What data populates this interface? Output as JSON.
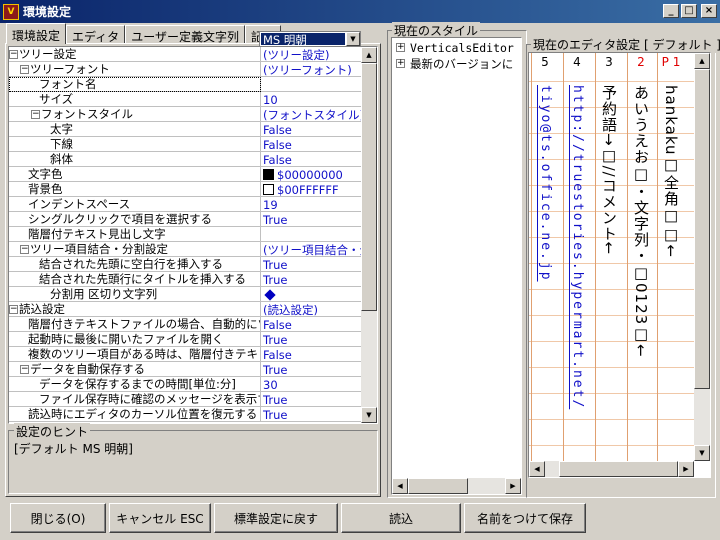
{
  "window": {
    "title": "環境設定",
    "buttons": {
      "minimize": "_",
      "maximize": "□",
      "close": "×"
    }
  },
  "tabs": [
    "環境設定",
    "エディタ",
    "ユーザー定義文字列",
    "記号"
  ],
  "settings": {
    "rows": [
      {
        "name": "ツリー設定",
        "value": "(ツリー設定)",
        "level": 0,
        "expander": "minus"
      },
      {
        "name": "ツリーフォント",
        "value": "(ツリーフォント)",
        "level": 1,
        "expander": "minus"
      },
      {
        "name": "フォント名",
        "value": "",
        "level": 2,
        "selected": true
      },
      {
        "name": "サイズ",
        "value": "10",
        "level": 2
      },
      {
        "name": "フォントスタイル",
        "value": "(フォントスタイル)",
        "level": 2,
        "expander": "minus"
      },
      {
        "name": "太字",
        "value": "False",
        "level": 3
      },
      {
        "name": "下線",
        "value": "False",
        "level": 3
      },
      {
        "name": "斜体",
        "value": "False",
        "level": 3
      },
      {
        "name": "文字色",
        "value": "$00000000",
        "level": 1,
        "swatch": "#000000"
      },
      {
        "name": "背景色",
        "value": "$00FFFFFF",
        "level": 1,
        "swatch": "#ffffff"
      },
      {
        "name": "インデントスペース",
        "value": "19",
        "level": 1
      },
      {
        "name": "シングルクリックで項目を選択する",
        "value": "True",
        "level": 1
      },
      {
        "name": "階層付テキスト見出し文字",
        "value": "",
        "level": 1
      },
      {
        "name": "ツリー項目結合・分割設定",
        "value": "(ツリー項目結合・分",
        "level": 1,
        "expander": "minus"
      },
      {
        "name": "結合された先頭に空白行を挿入する",
        "value": "True",
        "level": 2
      },
      {
        "name": "結合された先頭行にタイトルを挿入する",
        "value": "True",
        "level": 2
      },
      {
        "name": "分割用 区切り文字列",
        "value": "",
        "level": 3,
        "diamond": true
      },
      {
        "name": "読込設定",
        "value": "(読込設定)",
        "level": 0,
        "expander": "minus"
      },
      {
        "name": "階層付きテキストファイルの場合、自動的にツ",
        "value": "False",
        "level": 1
      },
      {
        "name": "起動時に最後に開いたファイルを開く",
        "value": "True",
        "level": 1
      },
      {
        "name": "複数のツリー項目がある時は、階層付きテキ",
        "value": "False",
        "level": 1
      },
      {
        "name": "データを自動保存する",
        "value": "True",
        "level": 1,
        "expander": "minus"
      },
      {
        "name": "データを保存するまでの時間[単位:分]",
        "value": "30",
        "level": 2
      },
      {
        "name": "ファイル保存時に確認のメッセージを表示す",
        "value": "True",
        "level": 2
      },
      {
        "name": "読込時にエディタのカーソル位置を復元する",
        "value": "True",
        "level": 1
      }
    ],
    "font_combo_value": "MS 明朝"
  },
  "hint": {
    "label": "設定のヒント",
    "text": "[デフォルト MS 明朝]"
  },
  "style_panel": {
    "label": "現在のスタイル",
    "items": [
      "VerticalsEditor",
      "最新のバージョンに"
    ]
  },
  "editor_panel": {
    "label": "現在のエディタ設定 [ デフォルト ]",
    "columns": [
      {
        "num": "P 1",
        "text": "hankaku□全角□□←",
        "red": true
      },
      {
        "num": "2",
        "text": "あいうえお□・文字列・□0123□←"
      },
      {
        "num": "3",
        "text": "予約語→□//コメント←"
      },
      {
        "num": "4",
        "text": "http://truestories.hypermart.net/",
        "link": true
      },
      {
        "num": "5",
        "text": "tiyo@ts.office.ne.jp",
        "link": true
      }
    ]
  },
  "buttons": {
    "close": "閉じる(O)",
    "cancel": "キャンセル ESC",
    "reset": "標準設定に戻す",
    "load": "読込",
    "save_as": "名前をつけて保存"
  }
}
